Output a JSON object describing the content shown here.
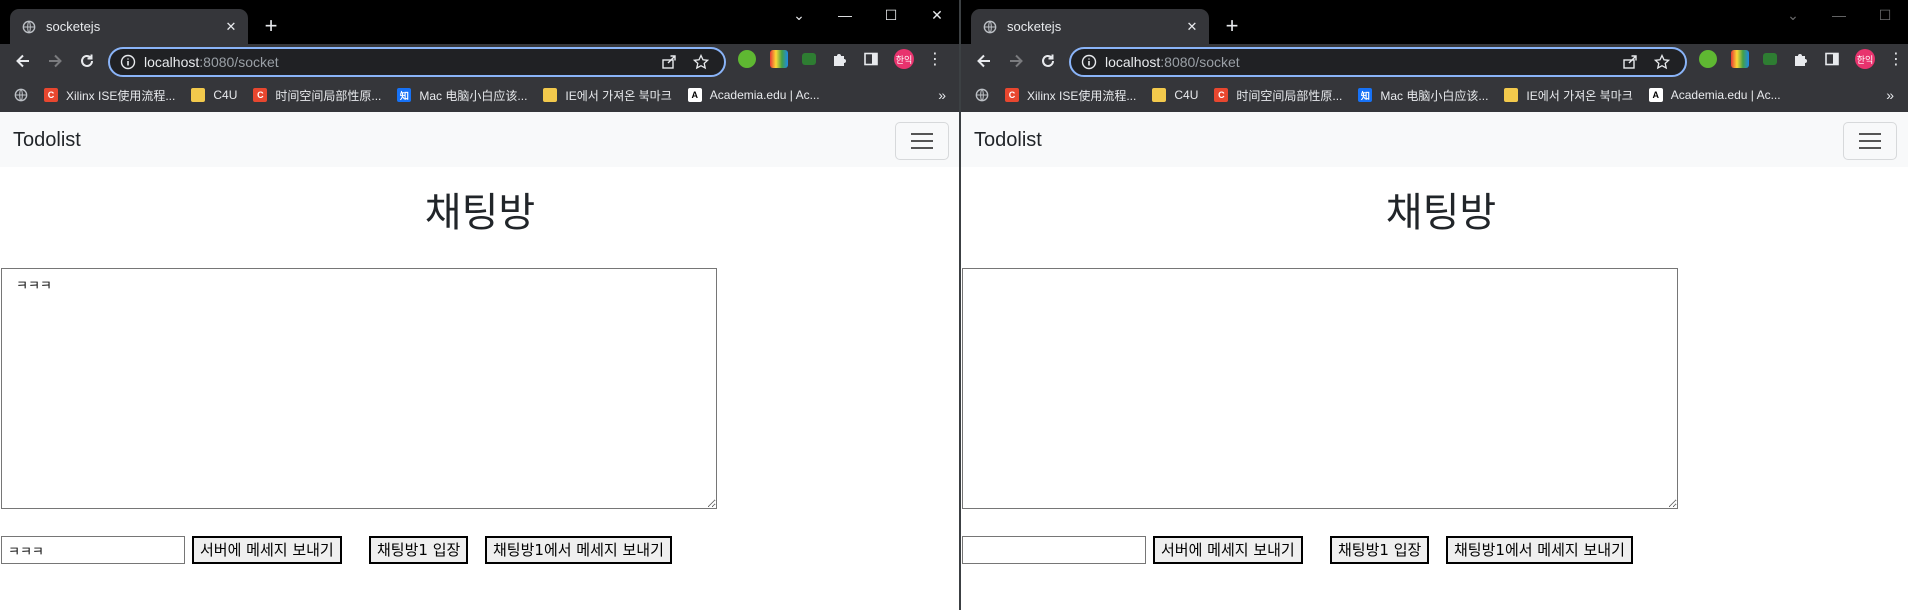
{
  "window_controls": {
    "minimize": "—",
    "maximize": "☐",
    "close": "✕",
    "dropdown": "⌄"
  },
  "bookmarks_more": "»",
  "windows": {
    "left": {
      "tab": {
        "title": "socketejs",
        "close": "✕",
        "new_tab": "+"
      },
      "url": {
        "host": "localhost",
        "rest": ":8080/socket"
      },
      "profile_label": "한익",
      "bookmarks": [
        {
          "label": "Xilinx ISE使用流程...",
          "icon": "C",
          "color": "#e8472f"
        },
        {
          "label": "C4U",
          "icon": "",
          "color": "#f2c94c"
        },
        {
          "label": "时间空间局部性原...",
          "icon": "C",
          "color": "#e8472f"
        },
        {
          "label": "Mac 电脑小白应该...",
          "icon": "知",
          "color": "#1772f6"
        },
        {
          "label": "IE에서 가져온 북마크",
          "icon": "",
          "color": "#f2c94c"
        },
        {
          "label": "Academia.edu | Ac...",
          "icon": "A",
          "color": "#ffffff"
        }
      ],
      "page": {
        "brand": "Todolist",
        "title": "채팅방",
        "chat_text": "ㅋㅋㅋ",
        "input_value": "ㅋㅋㅋ",
        "buttons": {
          "send_server": "서버에 메세지 보내기",
          "join_room": "채팅방1 입장",
          "send_room": "채팅방1에서 메세지 보내기"
        }
      }
    },
    "right": {
      "tab": {
        "title": "socketejs",
        "close": "✕",
        "new_tab": "+"
      },
      "url": {
        "host": "localhost",
        "rest": ":8080/socket"
      },
      "profile_label": "한익",
      "bookmarks": [
        {
          "label": "Xilinx ISE使用流程...",
          "icon": "C",
          "color": "#e8472f"
        },
        {
          "label": "C4U",
          "icon": "",
          "color": "#f2c94c"
        },
        {
          "label": "时间空间局部性原...",
          "icon": "C",
          "color": "#e8472f"
        },
        {
          "label": "Mac 电脑小白应该...",
          "icon": "知",
          "color": "#1772f6"
        },
        {
          "label": "IE에서 가져온 북마크",
          "icon": "",
          "color": "#f2c94c"
        },
        {
          "label": "Academia.edu | Ac...",
          "icon": "A",
          "color": "#ffffff"
        }
      ],
      "page": {
        "brand": "Todolist",
        "title": "채팅방",
        "chat_text": "",
        "input_value": "",
        "buttons": {
          "send_server": "서버에 메세지 보내기",
          "join_room": "채팅방1 입장",
          "send_room": "채팅방1에서 메세지 보내기"
        }
      }
    }
  }
}
